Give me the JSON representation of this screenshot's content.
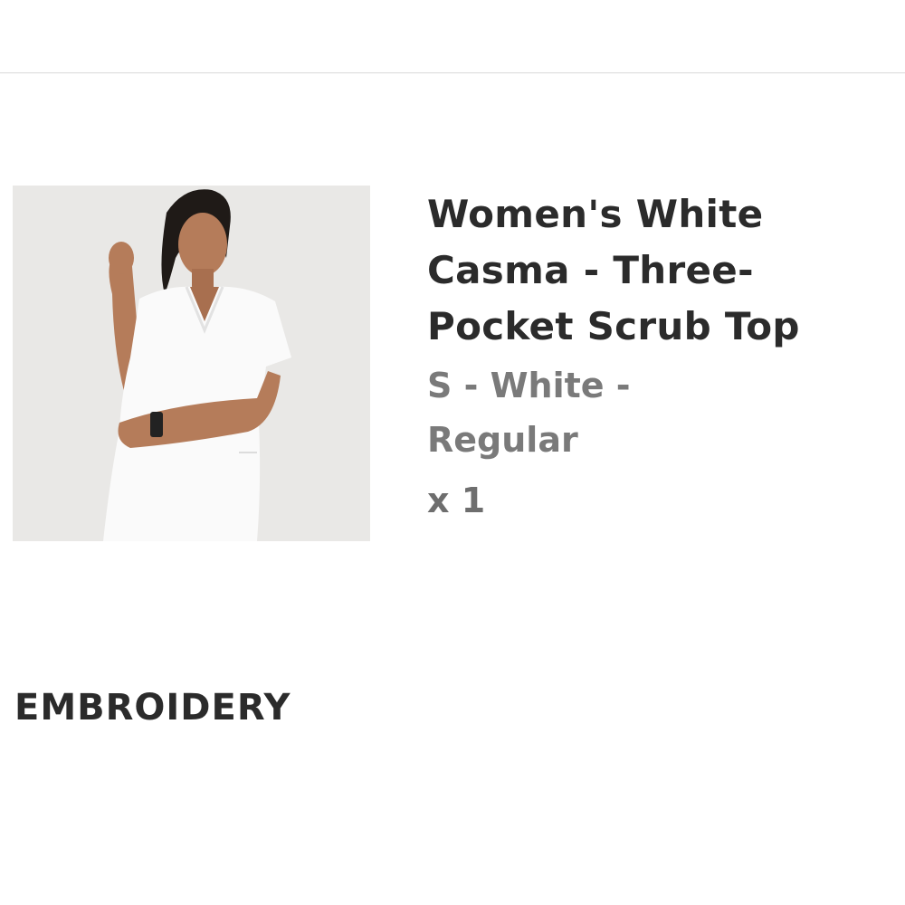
{
  "cart_item": {
    "title": "Women's White Casma - Three-Pocket Scrub Top",
    "variant": "S - White - Regular",
    "quantity": "x 1",
    "image_icon": "product-photo-scrub-top"
  },
  "sections": {
    "embroidery_heading": "EMBROIDERY"
  },
  "colors": {
    "title_text": "#2b2b2b",
    "variant_text": "#7a7a7a",
    "divider": "#d9d9d9",
    "image_background": "#e9e8e6"
  }
}
